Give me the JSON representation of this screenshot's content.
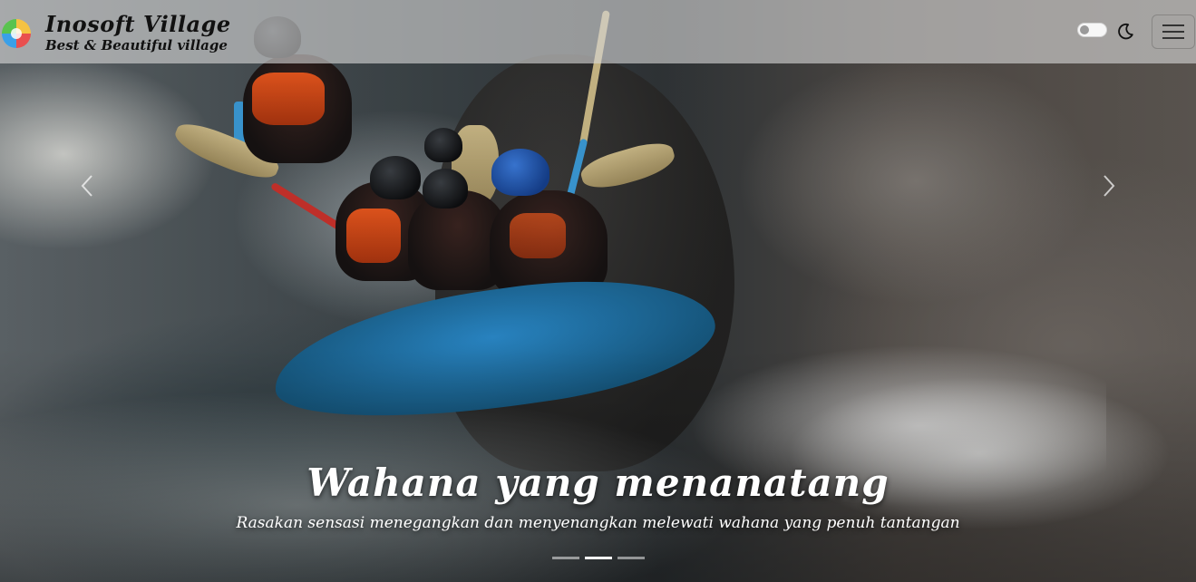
{
  "brand": {
    "title": "Inosoft Village",
    "subtitle": "Best & Beautiful village",
    "logo_icon": "colorful-circle-logo"
  },
  "navbar": {
    "theme_toggle_icon": "toggle-switch-icon",
    "dark_mode_icon": "moon-icon",
    "menu_icon": "hamburger-menu-icon"
  },
  "carousel": {
    "prev_icon": "chevron-left-icon",
    "next_icon": "chevron-right-icon",
    "active_index": 1,
    "slide_count": 3,
    "caption": {
      "title": "Wahana yang menanatang",
      "text": "Rasakan sensasi menegangkan dan menyenangkan melewati wahana yang penuh tantangan"
    }
  },
  "colors": {
    "navbar_bg": "#d7d7d7",
    "caption_text": "#ffffff",
    "indicator_active": "#ffffff"
  }
}
